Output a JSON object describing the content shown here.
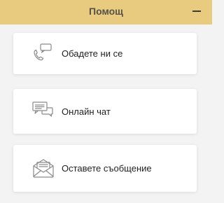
{
  "header": {
    "title": "Помощ",
    "collapse_icon": "minus-icon"
  },
  "options": [
    {
      "label": "Обадете ни се",
      "icon": "phone-chat-icon"
    },
    {
      "label": "Онлайн чат",
      "icon": "chat-bubbles-icon"
    },
    {
      "label": "Оставете съобщение",
      "icon": "envelope-icon"
    }
  ],
  "colors": {
    "header_bg": "#e8cb7f",
    "page_bg": "#f3f3f3",
    "card_bg": "#ffffff",
    "icon_stroke": "#8a8a8a"
  }
}
